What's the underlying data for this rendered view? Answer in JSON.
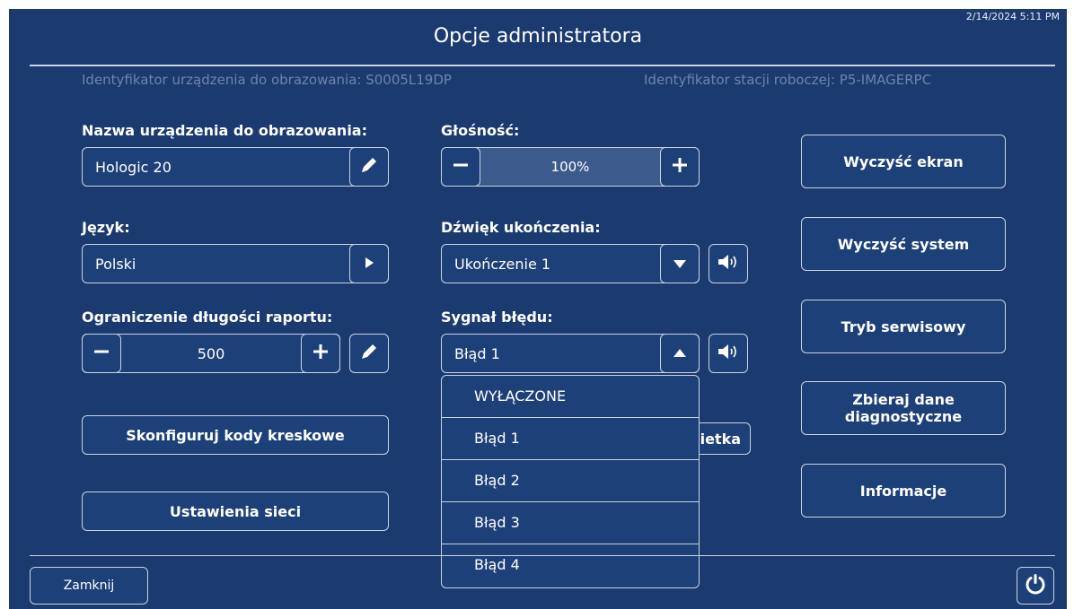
{
  "header": {
    "timestamp": "2/14/2024 5:11 PM",
    "title": "Opcje administratora",
    "device_id": "Identyfikator urządzenia do obrazowania: S0005L19DP",
    "workstation_id": "Identyfikator stacji roboczej: P5-IMAGERPC"
  },
  "device_name": {
    "label": "Nazwa urządzenia do obrazowania:",
    "value": "Hologic 20"
  },
  "language": {
    "label": "Język:",
    "value": "Polski"
  },
  "report_limit": {
    "label": "Ograniczenie długości raportu:",
    "value": "500"
  },
  "volume": {
    "label": "Głośność:",
    "value": "100%",
    "level_percent": 100
  },
  "completion_sound": {
    "label": "Dźwięk ukończenia:",
    "value": "Ukończenie 1"
  },
  "error_signal": {
    "label": "Sygnał błędu:",
    "value": "Błąd 1",
    "options": [
      "WYŁĄCZONE",
      "Błąd 1",
      "Błąd 2",
      "Błąd 3",
      "Błąd 4"
    ]
  },
  "left_buttons": {
    "barcodes": "Skonfiguruj kody kreskowe",
    "network": "Ustawienia sieci"
  },
  "hidden_button_fragment": "ietka",
  "right_buttons": {
    "clear_screen": "Wyczyść ekran",
    "clear_system": "Wyczyść system",
    "service_mode": "Tryb serwisowy",
    "collect_diag": "Zbieraj dane diagnostyczne",
    "info": "Informacje"
  },
  "footer": {
    "close": "Zamknij"
  }
}
